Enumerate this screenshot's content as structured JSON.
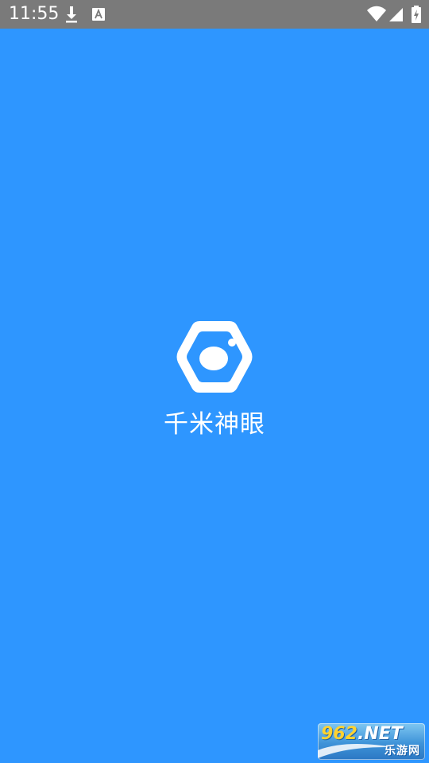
{
  "status_bar": {
    "time": "11:55",
    "icons": [
      "download-icon",
      "a-notification-icon",
      "wifi-icon",
      "signal-icon",
      "battery-charging-icon"
    ]
  },
  "splash": {
    "app_name": "千米神眼",
    "logo_icon": "hexagon-camera-icon"
  },
  "watermark": {
    "number": "962",
    "suffix": ".NET",
    "subtitle": "乐游网"
  },
  "colors": {
    "background": "#2E96FF",
    "status_bar": "#7A7A7A",
    "logo_fill": "#FFFFFF"
  }
}
